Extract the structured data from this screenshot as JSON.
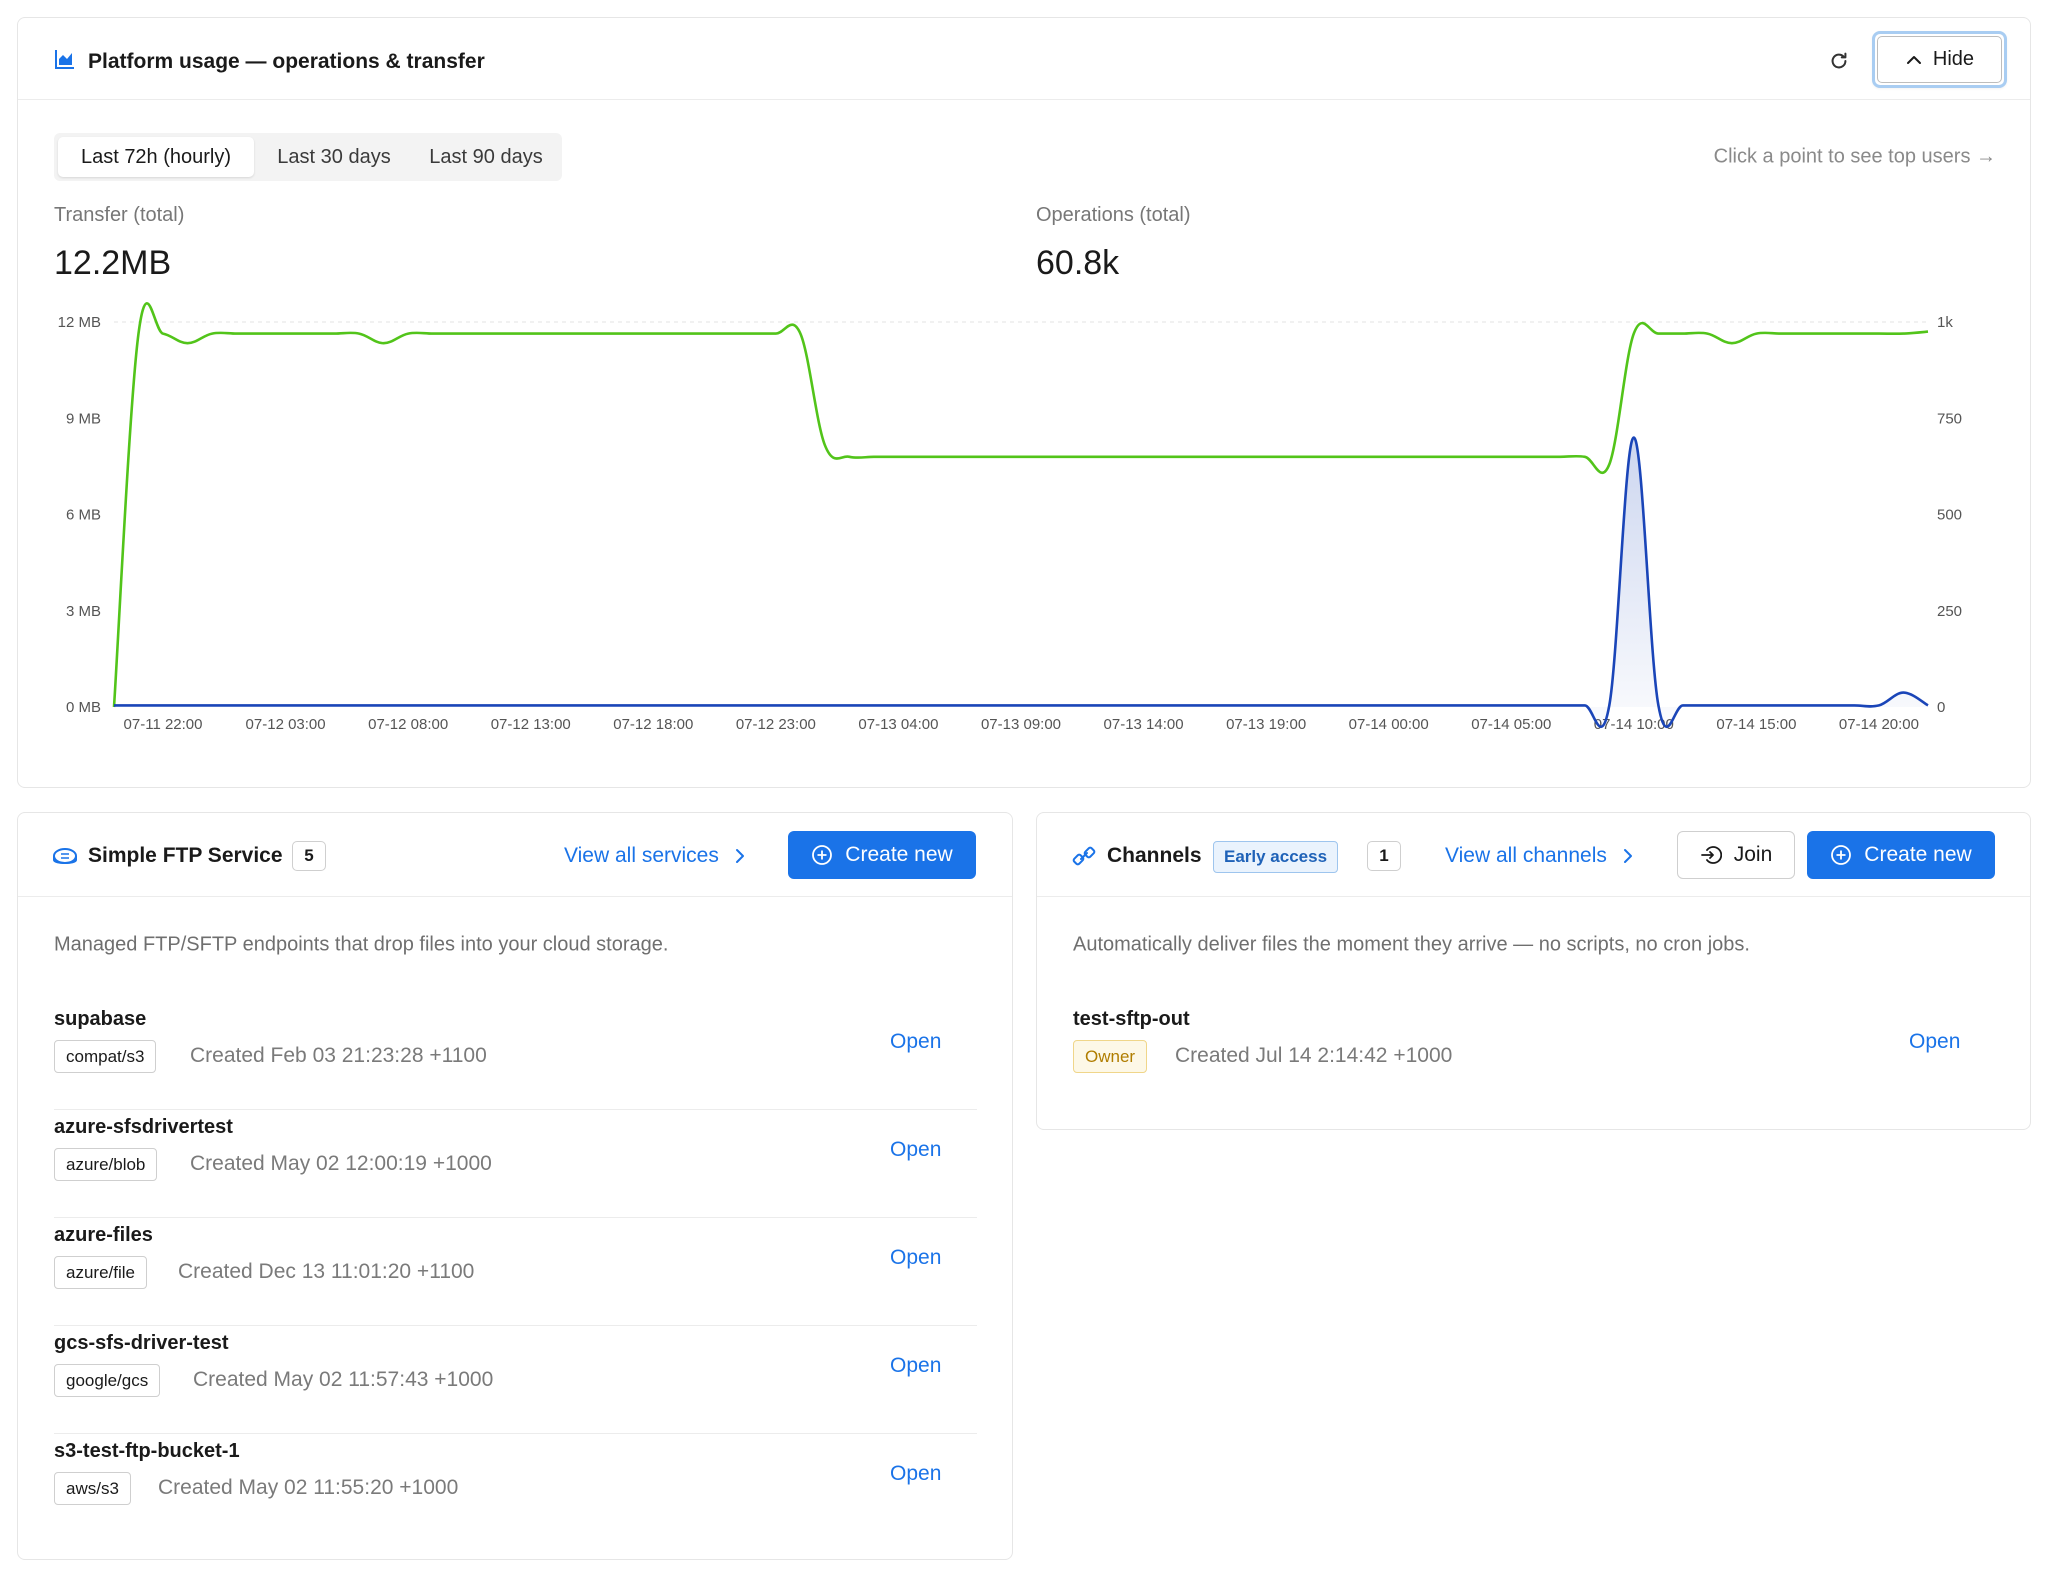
{
  "usage": {
    "title": "Platform usage — operations & transfer",
    "hide_label": "Hide",
    "ranges": [
      "Last 72h (hourly)",
      "Last 30 days",
      "Last 90 days"
    ],
    "active_range": "Last 72h (hourly)",
    "hint": "Click a point to see top users →",
    "transfer_label": "Transfer (total)",
    "transfer_value": "12.2MB",
    "operations_label": "Operations (total)",
    "operations_value": "60.8k",
    "colors": {
      "transfer": "#1a45b8",
      "operations": "#52c41a",
      "accent": "#1a73e8"
    }
  },
  "chart_data": {
    "type": "line",
    "x_unit": "hours since 07-11 20:00 (hourly points)",
    "x_ticks": [
      "07-11 22:00",
      "07-12 03:00",
      "07-12 08:00",
      "07-12 13:00",
      "07-12 18:00",
      "07-12 23:00",
      "07-13 04:00",
      "07-13 09:00",
      "07-13 14:00",
      "07-13 19:00",
      "07-14 00:00",
      "07-14 05:00",
      "07-14 10:00",
      "07-14 15:00",
      "07-14 20:00"
    ],
    "y_left": {
      "ticks": [
        "0 MB",
        "3 MB",
        "6 MB",
        "9 MB",
        "12 MB"
      ],
      "range": [
        0,
        12
      ]
    },
    "y_right": {
      "ticks": [
        "0",
        "250",
        "500",
        "750",
        "1k"
      ],
      "range": [
        0,
        1000
      ]
    },
    "grid": "top line only",
    "series": [
      {
        "axis": "right",
        "color": "#52c41a",
        "x": [
          0,
          1,
          2,
          3,
          4,
          5,
          6,
          7,
          8,
          9,
          10,
          11,
          12,
          13,
          14,
          15,
          16,
          17,
          18,
          19,
          20,
          21,
          22,
          23,
          24,
          25,
          26,
          27,
          28,
          29,
          30,
          31,
          32,
          33,
          34,
          35,
          36,
          37,
          38,
          39,
          40,
          41,
          42,
          43,
          44,
          45,
          46,
          47,
          48,
          49,
          50,
          51,
          52,
          53,
          54,
          55,
          56,
          57,
          58,
          59,
          60,
          61,
          62,
          63,
          64,
          65,
          66,
          67,
          68,
          69,
          70,
          71,
          72,
          73,
          74
        ],
        "values": [
          0,
          970,
          970,
          945,
          970,
          970,
          970,
          970,
          970,
          970,
          970,
          945,
          970,
          970,
          970,
          970,
          970,
          970,
          970,
          970,
          970,
          970,
          970,
          970,
          970,
          970,
          970,
          970,
          970,
          680,
          650,
          650,
          650,
          650,
          650,
          650,
          650,
          650,
          650,
          650,
          650,
          650,
          650,
          650,
          650,
          650,
          650,
          650,
          650,
          650,
          650,
          650,
          650,
          650,
          650,
          650,
          650,
          650,
          650,
          650,
          650,
          630,
          970,
          970,
          970,
          970,
          945,
          970,
          970,
          970,
          970,
          970,
          970,
          970,
          975
        ]
      },
      {
        "axis": "left",
        "color": "#1a45b8",
        "x": [
          0,
          1,
          2,
          3,
          4,
          5,
          6,
          7,
          8,
          9,
          10,
          11,
          12,
          13,
          14,
          15,
          16,
          17,
          18,
          19,
          20,
          21,
          22,
          23,
          24,
          25,
          26,
          27,
          28,
          29,
          30,
          31,
          32,
          33,
          34,
          35,
          36,
          37,
          38,
          39,
          40,
          41,
          42,
          43,
          44,
          45,
          46,
          47,
          48,
          49,
          50,
          51,
          52,
          53,
          54,
          55,
          56,
          57,
          58,
          59,
          60,
          61,
          62,
          63,
          64,
          65,
          66,
          67,
          68,
          69,
          70,
          71,
          72,
          73,
          74
        ],
        "values": [
          0.05,
          0.05,
          0.05,
          0.05,
          0.05,
          0.05,
          0.05,
          0.05,
          0.05,
          0.05,
          0.05,
          0.05,
          0.05,
          0.05,
          0.05,
          0.05,
          0.05,
          0.05,
          0.05,
          0.05,
          0.05,
          0.05,
          0.05,
          0.05,
          0.05,
          0.05,
          0.05,
          0.05,
          0.05,
          0.05,
          0.05,
          0.05,
          0.05,
          0.05,
          0.05,
          0.05,
          0.05,
          0.05,
          0.05,
          0.05,
          0.05,
          0.05,
          0.05,
          0.05,
          0.05,
          0.05,
          0.05,
          0.05,
          0.05,
          0.05,
          0.05,
          0.05,
          0.05,
          0.05,
          0.05,
          0.05,
          0.05,
          0.05,
          0.05,
          0.05,
          0.05,
          0.05,
          8.4,
          0.05,
          0.05,
          0.05,
          0.05,
          0.05,
          0.05,
          0.05,
          0.05,
          0.05,
          0.05,
          0.45,
          0.05
        ]
      }
    ]
  },
  "ftp": {
    "title": "Simple FTP Service",
    "count": "5",
    "view_all": "View all services",
    "create_label": "Create new",
    "description": "Managed FTP/SFTP endpoints that drop files into your cloud storage.",
    "open_label": "Open",
    "items": [
      {
        "name": "supabase",
        "tag": "compat/s3",
        "created": "Created Feb 03 21:23:28 +1100"
      },
      {
        "name": "azure-sfsdrivertest",
        "tag": "azure/blob",
        "created": "Created May 02 12:00:19 +1000"
      },
      {
        "name": "azure-files",
        "tag": "azure/file",
        "created": "Created Dec 13 11:01:20 +1100"
      },
      {
        "name": "gcs-sfs-driver-test",
        "tag": "google/gcs",
        "created": "Created May 02 11:57:43 +1000"
      },
      {
        "name": "s3-test-ftp-bucket-1",
        "tag": "aws/s3",
        "created": "Created May 02 11:55:20 +1000"
      }
    ]
  },
  "channels": {
    "title": "Channels",
    "badge": "Early access",
    "count": "1",
    "view_all": "View all channels",
    "join_label": "Join",
    "create_label": "Create new",
    "description": "Automatically deliver files the moment they arrive — no scripts, no cron jobs.",
    "open_label": "Open",
    "items": [
      {
        "name": "test-sftp-out",
        "tag": "Owner",
        "created": "Created Jul 14 2:14:42 +1000"
      }
    ]
  }
}
